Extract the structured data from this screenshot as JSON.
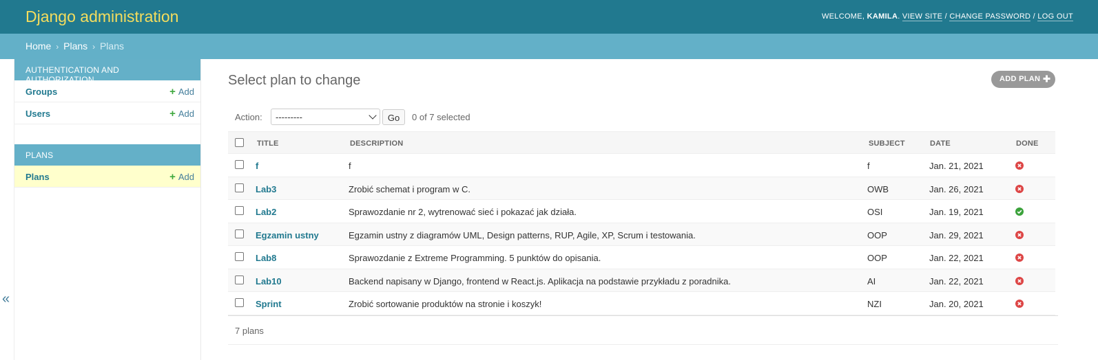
{
  "header": {
    "brand": "Django administration",
    "welcome_prefix": "WELCOME, ",
    "username": "KAMILA",
    "after_user": ". ",
    "view_site": "VIEW SITE",
    "sep1": " / ",
    "change_password": "CHANGE PASSWORD",
    "sep2": " / ",
    "log_out": "LOG OUT"
  },
  "breadcrumbs": {
    "home": "Home",
    "sep": "›",
    "app": "Plans",
    "current": "Plans"
  },
  "sidebar": {
    "modules": [
      {
        "caption": "AUTHENTICATION AND AUTHORIZATION",
        "models": [
          {
            "name": "Groups",
            "add": "Add"
          },
          {
            "name": "Users",
            "add": "Add"
          }
        ]
      },
      {
        "caption": "PLANS",
        "models": [
          {
            "name": "Plans",
            "add": "Add"
          }
        ]
      }
    ],
    "toggle": "«"
  },
  "content": {
    "title": "Select plan to change",
    "add_button": "ADD PLAN"
  },
  "actions": {
    "label": "Action:",
    "selected": "---------",
    "go": "Go",
    "counter": "0 of 7 selected"
  },
  "table": {
    "headers": [
      "TITLE",
      "DESCRIPTION",
      "SUBJECT",
      "DATE",
      "DONE"
    ],
    "rows": [
      {
        "title": "f",
        "description": "f",
        "subject": "f",
        "date": "Jan. 21, 2021",
        "done": false
      },
      {
        "title": "Lab3",
        "description": "Zrobić schemat i program w C.",
        "subject": "OWB",
        "date": "Jan. 26, 2021",
        "done": false
      },
      {
        "title": "Lab2",
        "description": "Sprawozdanie nr 2, wytrenować sieć i pokazać jak działa.",
        "subject": "OSI",
        "date": "Jan. 19, 2021",
        "done": true
      },
      {
        "title": "Egzamin ustny",
        "description": "Egzamin ustny z diagramów UML, Design patterns, RUP, Agile, XP, Scrum i testowania.",
        "subject": "OOP",
        "date": "Jan. 29, 2021",
        "done": false
      },
      {
        "title": "Lab8",
        "description": "Sprawozdanie z Extreme Programming. 5 punktów do opisania.",
        "subject": "OOP",
        "date": "Jan. 22, 2021",
        "done": false
      },
      {
        "title": "Lab10",
        "description": "Backend napisany w Django, frontend w React.js. Aplikacja na podstawie przykładu z poradnika.",
        "subject": "AI",
        "date": "Jan. 22, 2021",
        "done": false
      },
      {
        "title": "Sprint",
        "description": "Zrobić sortowanie produktów na stronie i koszyk!",
        "subject": "NZI",
        "date": "Jan. 20, 2021",
        "done": false
      }
    ]
  },
  "paginator": "7 plans",
  "colors": {
    "header_bg": "#21798f",
    "brand": "#f5dd5d",
    "breadcrumb_bg": "#63b0c8",
    "link": "#21798f",
    "add_green": "#3ea83e",
    "done_yes": "#3ba23b",
    "done_no": "#dd4646"
  }
}
